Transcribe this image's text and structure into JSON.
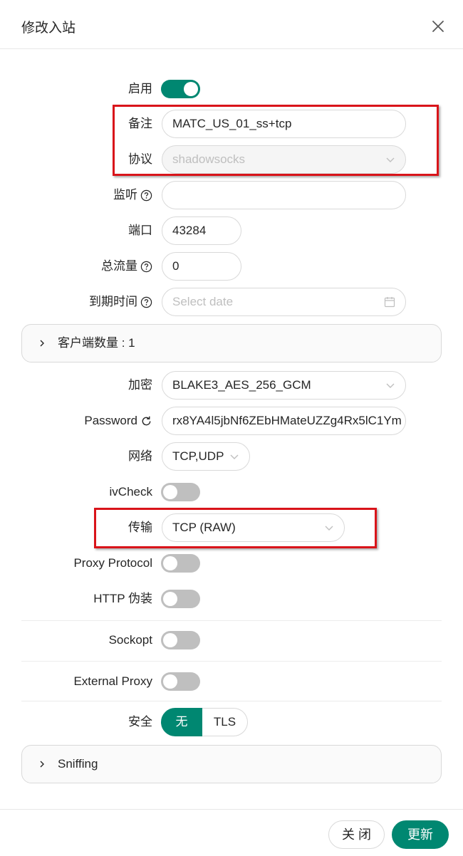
{
  "modal": {
    "title": "修改入站"
  },
  "form": {
    "enable": {
      "label": "启用",
      "on": true
    },
    "remark": {
      "label": "备注",
      "value": "MATC_US_01_ss+tcp"
    },
    "protocol": {
      "label": "协议",
      "value": "shadowsocks"
    },
    "listen": {
      "label": "监听",
      "value": ""
    },
    "port": {
      "label": "端口",
      "value": "43284"
    },
    "total_traffic": {
      "label": "总流量",
      "value": "0"
    },
    "expiry": {
      "label": "到期时间",
      "placeholder": "Select date"
    },
    "clients": {
      "label": "客户端数量 : 1"
    },
    "encryption": {
      "label": "加密",
      "value": "BLAKE3_AES_256_GCM"
    },
    "password": {
      "label": "Password",
      "value": "rx8YA4l5jbNf6ZEbHMateUZZg4Rx5lC1Ym"
    },
    "network": {
      "label": "网络",
      "value": "TCP,UDP"
    },
    "ivcheck": {
      "label": "ivCheck",
      "on": false
    },
    "transport": {
      "label": "传输",
      "value": "TCP (RAW)"
    },
    "proxy_protocol": {
      "label": "Proxy Protocol",
      "on": false
    },
    "http_disguise": {
      "label": "HTTP 伪装",
      "on": false
    },
    "sockopt": {
      "label": "Sockopt",
      "on": false
    },
    "external_proxy": {
      "label": "External Proxy",
      "on": false
    },
    "security": {
      "label": "安全",
      "options": [
        "无",
        "TLS"
      ],
      "selected": "无"
    },
    "sniffing": {
      "label": "Sniffing"
    }
  },
  "footer": {
    "close_label": "关 闭",
    "update_label": "更新"
  },
  "colors": {
    "accent": "#008771",
    "highlight_box": "#d9141a"
  }
}
